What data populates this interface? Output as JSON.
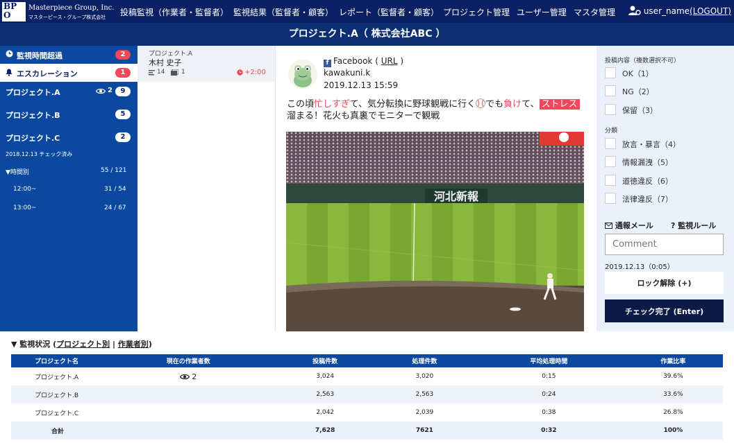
{
  "header": {
    "logo_letters": "BP\nO",
    "company": "Masterpiece Group, Inc.",
    "company_sub": "マスターピース・グループ株式会社",
    "nav": [
      "投稿監視（作業者・監督者）",
      "監視結果（監督者・顧客）",
      "レポート（監督者・顧客）",
      "プロジェクト管理",
      "ユーザー管理",
      "マスタ管理"
    ],
    "user_name": "user_name",
    "logout": "(LOGOUT)"
  },
  "title": "プロジェクト.A（ 株式会社ABC ）",
  "left": {
    "overdue_label": "監視時間超過",
    "overdue_count": "2",
    "escalation_label": "エスカレーション",
    "escalation_count": "1",
    "projects": [
      {
        "name": "プロジェクト.A",
        "viewers": "2",
        "count": "9"
      },
      {
        "name": "プロジェクト.B",
        "count": "5"
      },
      {
        "name": "プロジェクト.C",
        "count": "2"
      }
    ],
    "checked_note": "2018.12.13 チェック済み",
    "hourly_label": "▼時間別",
    "hourly_total": "55 / 121",
    "hours": [
      {
        "time": "12:00~",
        "value": "31 / 54"
      },
      {
        "time": "13:00~",
        "value": "24 / 67"
      }
    ]
  },
  "list": {
    "project": "プロジェクト.A",
    "name": "木村 史子",
    "posts": "14",
    "images": "1",
    "time": "+2:00"
  },
  "post": {
    "source": "Facebook",
    "url_label": "URL",
    "author": "kawakuni.k",
    "datetime": "2019.12.13 15:59",
    "text_1": "この頃",
    "text_red1": "忙しすぎ",
    "text_2": "て、気分転換に野球観戦に行く",
    "text_3": "でも",
    "text_red2": "負け",
    "text_4": "て、",
    "text_hl": "ストレス",
    "text_5": "溜まる！花火も真裏でモニターで観戦",
    "banner": "河北新報"
  },
  "right": {
    "content_heading": "投稿内容（複数選択不可）",
    "content_options": [
      "OK（1）",
      "NG（2）",
      "保留（3）"
    ],
    "class_heading": "分類",
    "class_options": [
      "放言・暴言（4）",
      "情報漏洩（5）",
      "道徳違反（6）",
      "法律違反（7）"
    ],
    "mail_label": "通報メール",
    "rule_label": "監視ルール",
    "comment_placeholder": "Comment",
    "timestamp": "2019.12.13（0:05）",
    "unlock_label": "ロック解除 (+)",
    "done_label": "チェック完了 (Enter)"
  },
  "status": {
    "heading_prefix": "▼ 監視状況 (",
    "heading_by_project": "プロジェクト別",
    "heading_sep": " | ",
    "heading_by_worker": "作業者別",
    "heading_suffix": ")",
    "columns": [
      "プロジェクト名",
      "現在の作業者数",
      "投稿件数",
      "処理件数",
      "平均処理時間",
      "作業比率"
    ],
    "rows": [
      {
        "name": "プロジェクト.A",
        "workers": "2",
        "posts": "3,024",
        "processed": "3,020",
        "avg": "0:15",
        "ratio": "39.6%"
      },
      {
        "name": "プロジェクト.B",
        "workers": "",
        "posts": "2,563",
        "processed": "2,563",
        "avg": "0:24",
        "ratio": "33.6%"
      },
      {
        "name": "プロジェクト.C",
        "workers": "",
        "posts": "2,042",
        "processed": "2,039",
        "avg": "0:38",
        "ratio": "26.8%"
      }
    ],
    "total": {
      "name": "合計",
      "posts": "7,628",
      "processed": "7621",
      "avg": "0:32",
      "ratio": "100%"
    }
  }
}
